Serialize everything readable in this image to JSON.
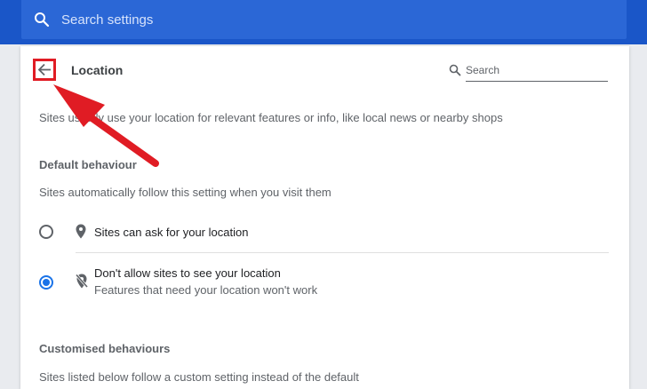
{
  "top_search": {
    "placeholder": "Search settings",
    "icon": "search-icon"
  },
  "header": {
    "title": "Location",
    "search_label": "Search",
    "back_icon": "arrow-back-icon"
  },
  "description": "Sites usually use your location for relevant features or info, like local news or nearby shops",
  "default_behaviour": {
    "title": "Default behaviour",
    "subtitle": "Sites automatically follow this setting when you visit them",
    "options": [
      {
        "label": "Sites can ask for your location",
        "selected": false,
        "icon": "location-pin-icon"
      },
      {
        "label": "Don't allow sites to see your location",
        "sublabel": "Features that need your location won't work",
        "selected": true,
        "icon": "location-off-icon"
      }
    ]
  },
  "customised_behaviours": {
    "title": "Customised behaviours",
    "subtitle": "Sites listed below follow a custom setting instead of the default"
  },
  "colors": {
    "brand_blue": "#1a56c8",
    "accent": "#1a73e8",
    "annotation_red": "#e01c24"
  }
}
